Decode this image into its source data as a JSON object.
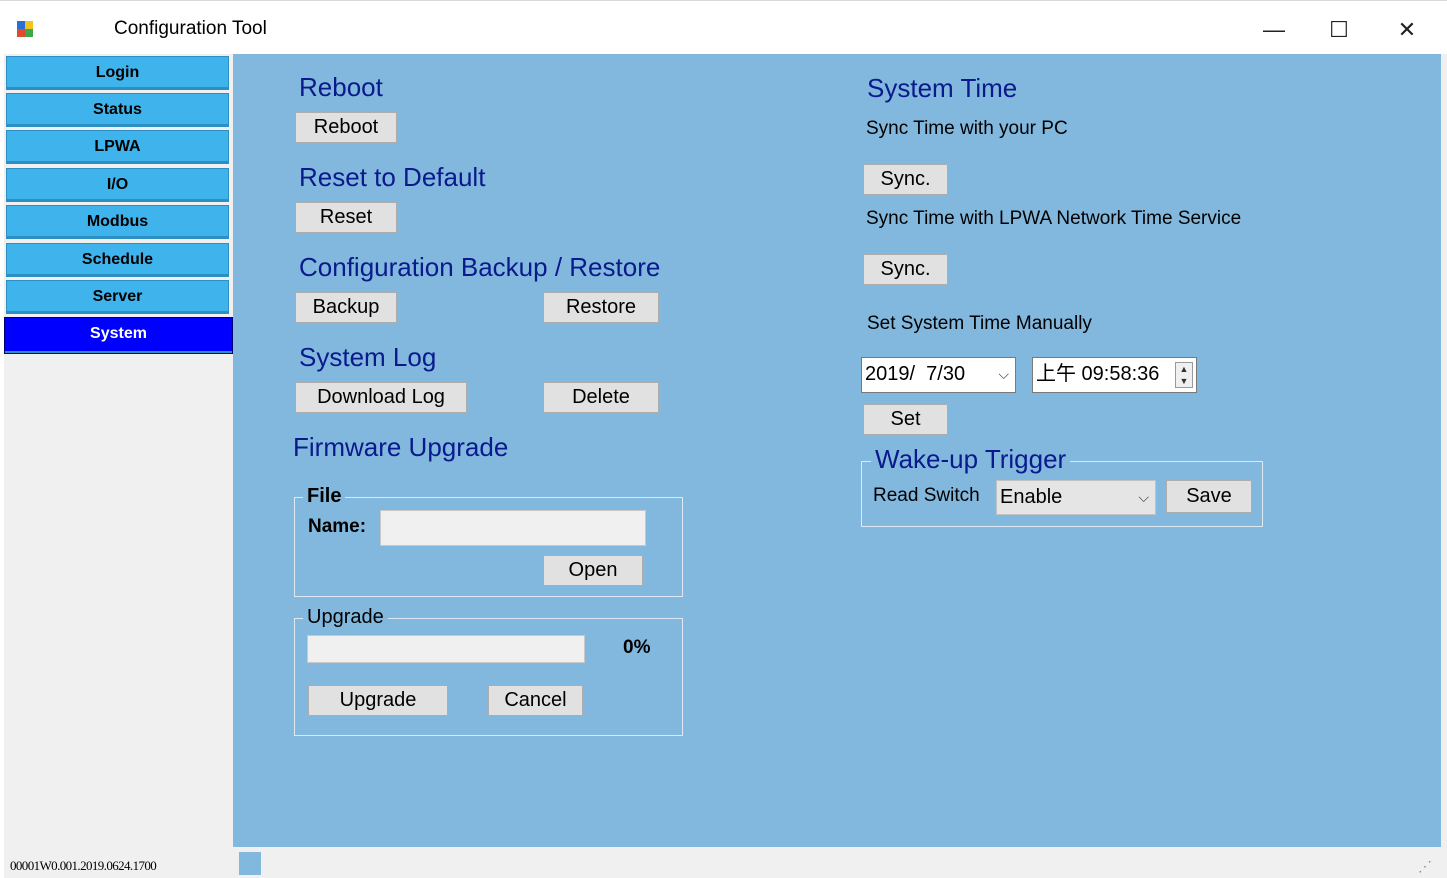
{
  "window": {
    "title": "Configuration Tool",
    "minimize_glyph": "—",
    "maximize_glyph": "☐",
    "close_glyph": "✕"
  },
  "sidebar": {
    "items": [
      {
        "label": "Login"
      },
      {
        "label": "Status"
      },
      {
        "label": "LPWA"
      },
      {
        "label": "I/O"
      },
      {
        "label": "Modbus"
      },
      {
        "label": "Schedule"
      },
      {
        "label": "Server"
      },
      {
        "label": "System",
        "active": true
      }
    ],
    "version": "00001W0.001.2019.0624.1700"
  },
  "reboot": {
    "heading": "Reboot",
    "button": "Reboot"
  },
  "reset": {
    "heading": "Reset to Default",
    "button": "Reset"
  },
  "backup": {
    "heading": "Configuration Backup / Restore",
    "backup_button": "Backup",
    "restore_button": "Restore"
  },
  "log": {
    "heading": "System Log",
    "download_button": "Download Log",
    "delete_button": "Delete"
  },
  "firmware": {
    "heading": "Firmware Upgrade",
    "file_group": "File",
    "name_label": "Name:",
    "name_value": "",
    "open_button": "Open",
    "upgrade_group": "Upgrade",
    "progress": 0,
    "progress_text": "0%",
    "upgrade_button": "Upgrade",
    "cancel_button": "Cancel"
  },
  "system_time": {
    "heading": "System Time",
    "sync_pc_label": "Sync Time with your PC",
    "sync_pc_button": "Sync.",
    "sync_lpwa_label": "Sync Time with LPWA Network Time Service",
    "sync_lpwa_button": "Sync.",
    "manual_label": "Set System Time Manually",
    "date_value": "2019/  7/30",
    "time_value": "上午 09:58:36",
    "set_button": "Set"
  },
  "wakeup": {
    "heading": "Wake-up Trigger",
    "read_switch_label": "Read Switch",
    "read_switch_value": "Enable",
    "save_button": "Save"
  },
  "colors": {
    "panel_bg": "#82b8dd",
    "nav_bg": "#3fb3ec",
    "nav_active_bg": "#0000ff",
    "heading_color": "#0a1a8c"
  }
}
